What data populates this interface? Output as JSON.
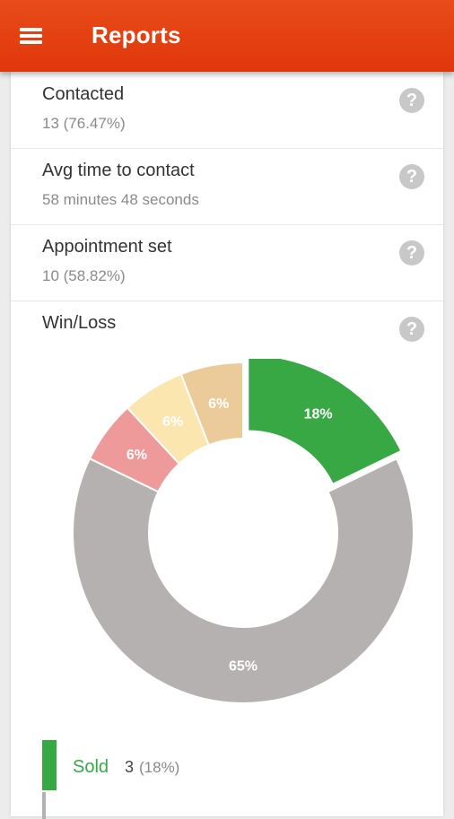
{
  "appbar": {
    "title": "Reports",
    "menu_icon": "hamburger-menu-icon"
  },
  "colors": {
    "appbar": "#e43f12",
    "sold": "#37a844",
    "other": "#b5b1b1",
    "pink": "#ef9a9a",
    "cream": "#fbe6b0",
    "tan": "#eccb9b"
  },
  "metrics": [
    {
      "title": "Contacted",
      "value": "13 (76.47%)",
      "help_icon": "help-icon"
    },
    {
      "title": "Avg time to contact",
      "value": "58 minutes 48 seconds",
      "help_icon": "help-icon"
    },
    {
      "title": "Appointment set",
      "value": "10 (58.82%)",
      "help_icon": "help-icon"
    },
    {
      "title": "Win/Loss",
      "help_icon": "help-icon"
    }
  ],
  "chart_data": {
    "type": "pie",
    "style": "donut",
    "slices": [
      {
        "label": "18%",
        "value": 18,
        "color": "#37a844",
        "legend": "Sold"
      },
      {
        "label": "65%",
        "value": 65,
        "color": "#b5b1b1"
      },
      {
        "label": "6%",
        "value": 6,
        "color": "#ef9a9a"
      },
      {
        "label": "6%",
        "value": 6,
        "color": "#fbe6b0"
      },
      {
        "label": "6%",
        "value": 6,
        "color": "#eccb9b"
      }
    ]
  },
  "legend": [
    {
      "label": "Sold",
      "count": "3",
      "percent": "(18%)",
      "color": "#37a844"
    }
  ]
}
